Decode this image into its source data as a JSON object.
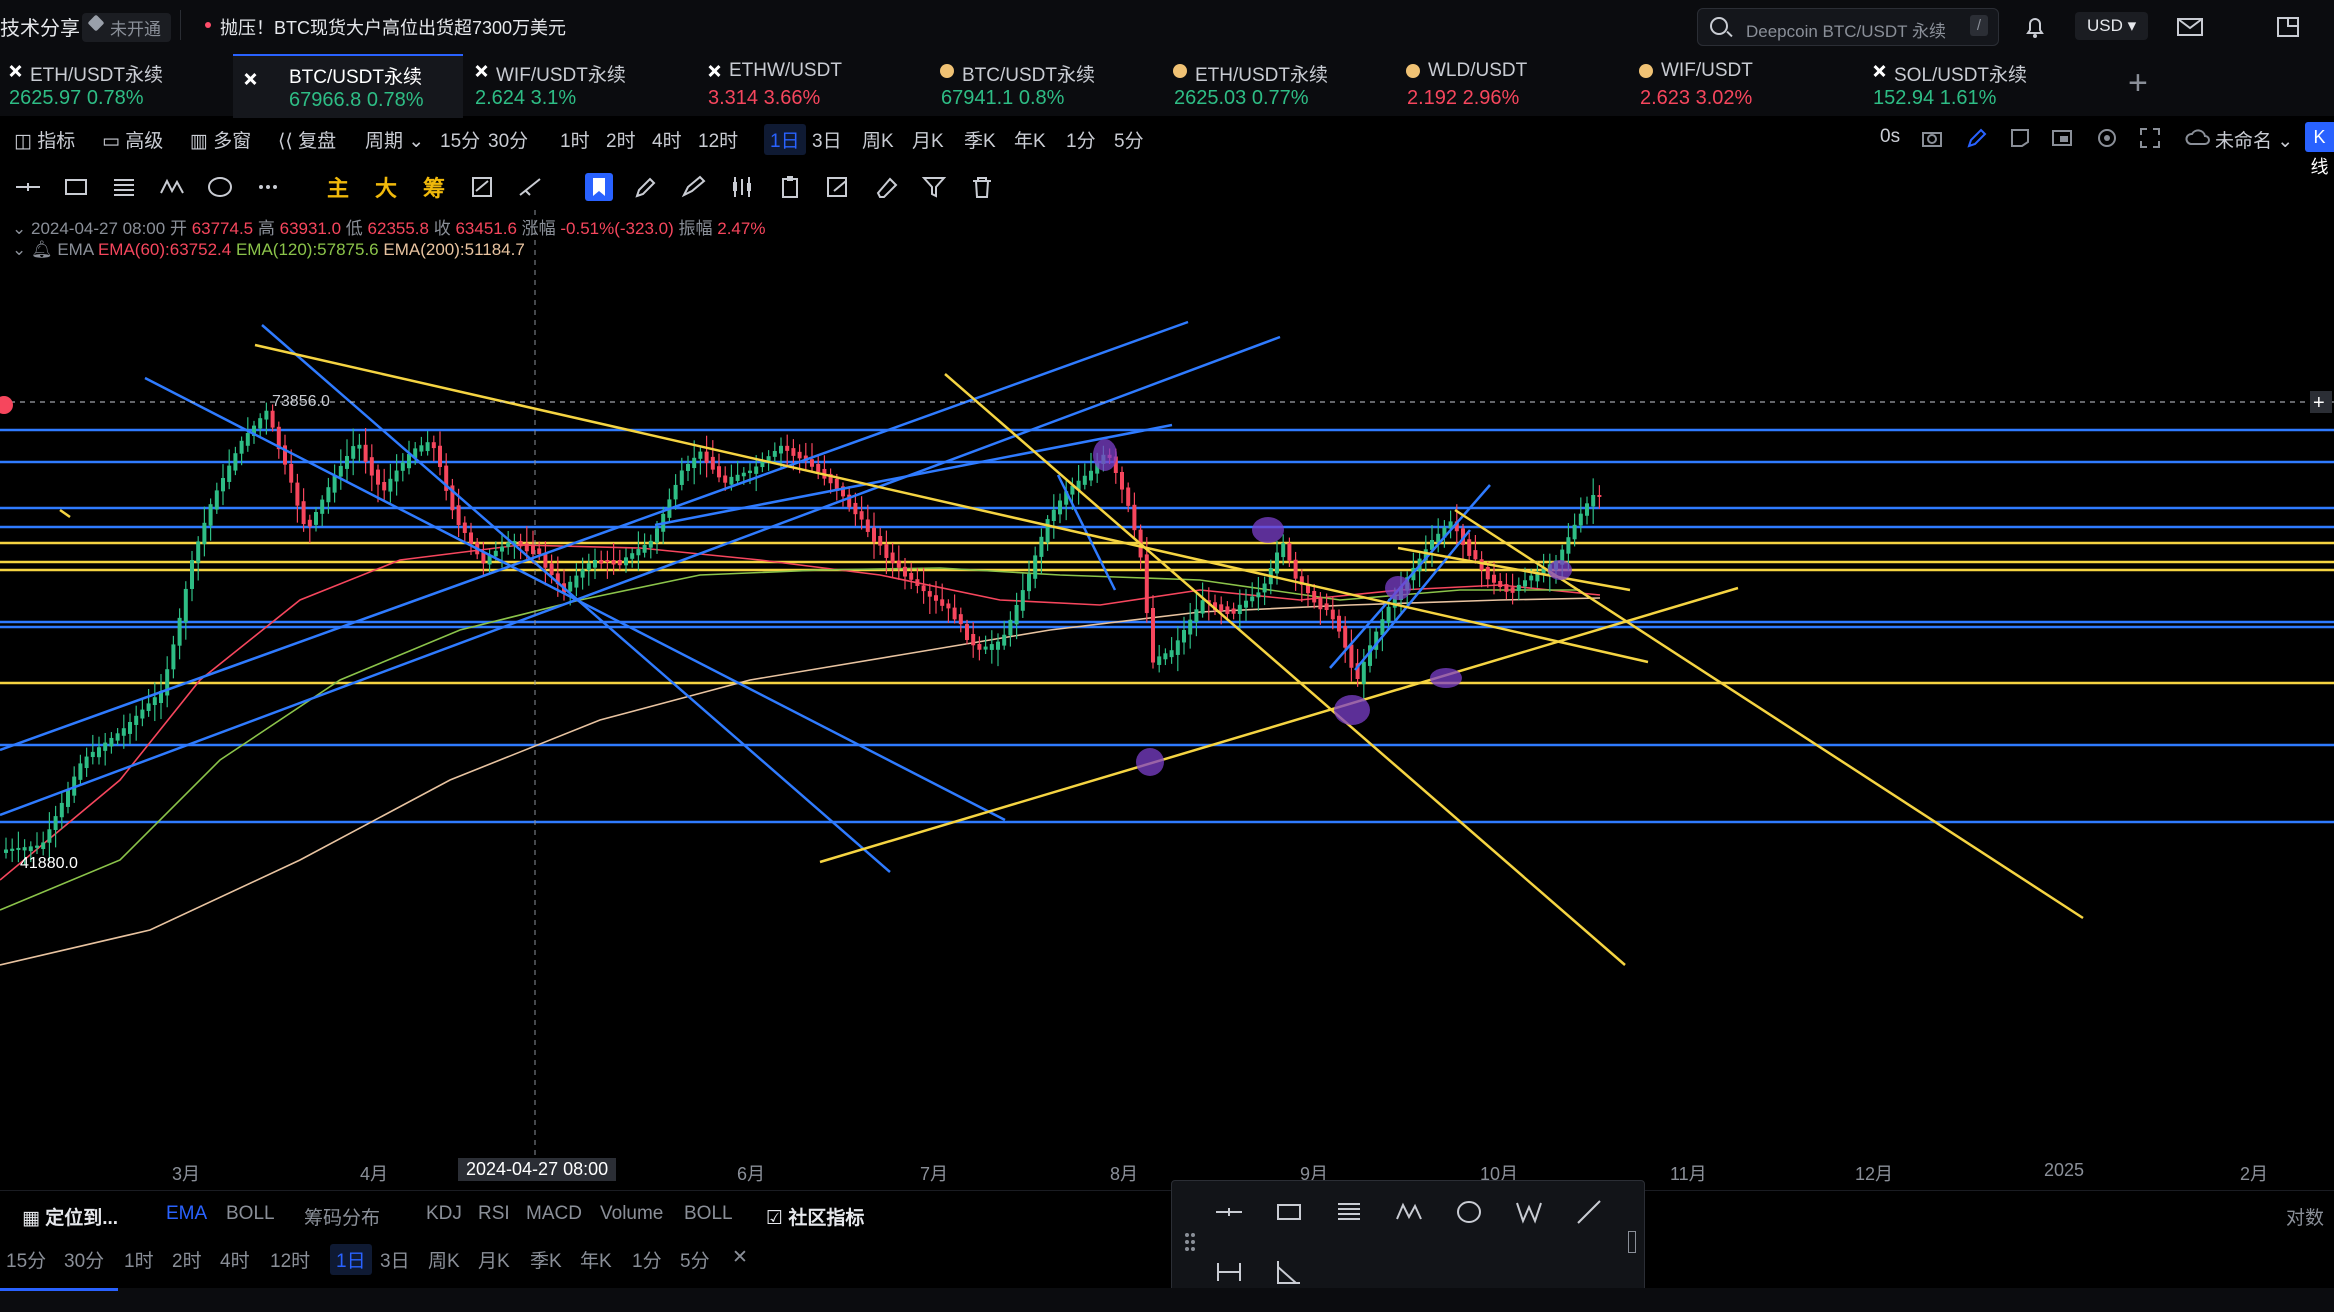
{
  "topbar": {
    "brand": "技术分享",
    "badge": "未开通",
    "news": "抛压！BTC现货大户高位出货超7300万美元",
    "search_placeholder": "Deepcoin BTC/USDT 永续",
    "search_shortcut": "/",
    "currency": "USD"
  },
  "tickers": [
    {
      "name": "ETH/USDT永续",
      "price": "2625.97",
      "change": "0.78%",
      "icon": "x-icon"
    },
    {
      "name": "BTC/USDT永续",
      "price": "67966.8",
      "change": "0.78%",
      "icon": "x-icon",
      "active": true
    },
    {
      "name": "WIF/USDT永续",
      "price": "2.624",
      "change": "3.1%",
      "icon": "x-icon"
    },
    {
      "name": "ETHW/USDT",
      "price": "3.314",
      "change": "3.66%",
      "icon": "x-icon",
      "down": true
    },
    {
      "name": "BTC/USDT永续",
      "price": "67941.1",
      "change": "0.8%",
      "icon": "coin-icon"
    },
    {
      "name": "ETH/USDT永续",
      "price": "2625.03",
      "change": "0.77%",
      "icon": "coin-icon"
    },
    {
      "name": "WLD/USDT",
      "price": "2.192",
      "change": "2.96%",
      "icon": "coin-icon",
      "down": true
    },
    {
      "name": "WIF/USDT",
      "price": "2.623",
      "change": "3.02%",
      "icon": "coin-icon",
      "down": true
    },
    {
      "name": "SOL/USDT永续",
      "price": "152.94",
      "change": "1.61%",
      "icon": "x-icon"
    }
  ],
  "toolbar": {
    "indicators": "指标",
    "advanced": "高级",
    "multi": "多窗",
    "replay": "复盘",
    "period": "周期",
    "intervals": [
      "15分",
      "30分",
      "1时",
      "2时",
      "4时",
      "12时",
      "1日",
      "3日",
      "周K",
      "月K",
      "季K",
      "年K",
      "1分",
      "5分"
    ],
    "active_interval": "1日",
    "countdown": "0s",
    "layout_name": "未命名",
    "k_button": "K线"
  },
  "draw_toolbar": {
    "main": "主",
    "big": "大",
    "chips": "筹"
  },
  "legend": {
    "datetime": "2024-04-27 08:00",
    "open_label": "开",
    "open": "63774.5",
    "high_label": "高",
    "high": "63931.0",
    "low_label": "低",
    "low": "62355.8",
    "close_label": "收",
    "close": "63451.6",
    "change_label": "涨幅",
    "change": "-0.51%(-323.0)",
    "amp_label": "振幅",
    "amp": "2.47%",
    "ema_title": "EMA",
    "ema60": "EMA(60):63752.4",
    "ema120": "EMA(120):57875.6",
    "ema200": "EMA(200):51184.7"
  },
  "chart_data": {
    "type": "candlestick",
    "symbol": "BTC/USDT永续",
    "interval": "1日",
    "high_marker": "73856.0",
    "low_marker": "41880.0",
    "x_ticks": [
      "3月",
      "4月",
      "2024-04-27 08:00",
      "6月",
      "7月",
      "8月",
      "9月",
      "10月",
      "11月",
      "12月",
      "2025",
      "2月"
    ],
    "indicators": [
      "EMA(60)",
      "EMA(120)",
      "EMA(200)"
    ],
    "colors": {
      "up": "#2ebd85",
      "down": "#f6465d",
      "trend_blue": "#2f7bff",
      "trend_yellow": "#f5d442",
      "marker": "#7b3fc9"
    }
  },
  "bottom": {
    "locate": "定位到...",
    "tabs": [
      "EMA",
      "BOLL",
      "筹码分布",
      "KDJ",
      "RSI",
      "MACD",
      "Volume",
      "BOLL"
    ],
    "community": "社区指标",
    "scale_mode": "对数",
    "intervals": [
      "15分",
      "30分",
      "1时",
      "2时",
      "4时",
      "12时",
      "1日",
      "3日",
      "周K",
      "月K",
      "季K",
      "年K",
      "1分",
      "5分"
    ],
    "active_interval": "1日"
  }
}
